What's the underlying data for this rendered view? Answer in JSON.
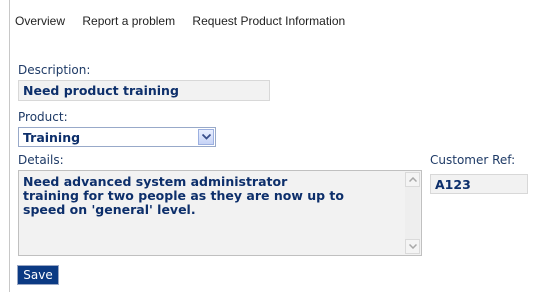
{
  "nav": {
    "items": [
      "Overview",
      "Report a problem",
      "Request Product Information"
    ]
  },
  "form": {
    "description_label": "Description:",
    "description_value": "Need product training",
    "product_label": "Product:",
    "product_value": "Training",
    "details_label": "Details:",
    "details_value": "Need advanced system administrator\ntraining for two people as they are now up to\nspeed on 'general' level.",
    "customer_ref_label": "Customer Ref:",
    "customer_ref_value": "A123",
    "save_label": "Save"
  },
  "colors": {
    "label": "#1e3a66",
    "value": "#0d2f6b",
    "save_bg": "#0b3a83"
  }
}
